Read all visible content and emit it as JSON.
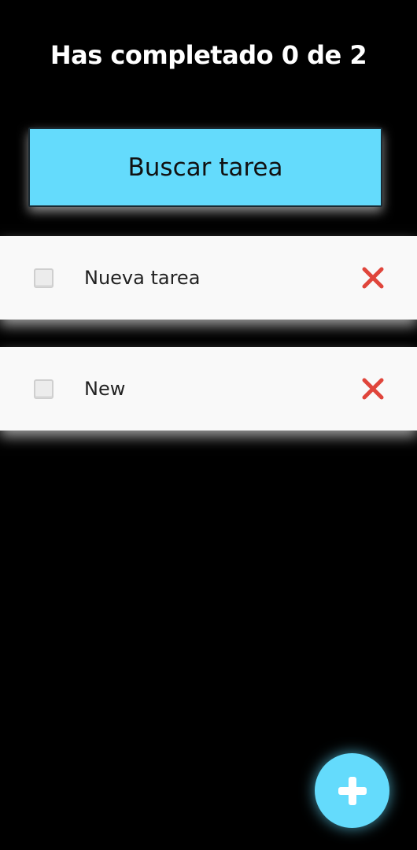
{
  "header": {
    "title": "Has completado 0 de 2"
  },
  "search": {
    "button_label": "Buscar tarea"
  },
  "tasks": [
    {
      "label": "Nueva tarea",
      "completed": false,
      "delete_icon": "close-icon"
    },
    {
      "label": "New",
      "completed": false,
      "delete_icon": "close-icon"
    }
  ],
  "fab": {
    "icon": "plus-icon"
  },
  "colors": {
    "background": "#000000",
    "accent": "#64dbfc",
    "task_background": "#f9f9f9",
    "delete_red": "#e0453b"
  }
}
